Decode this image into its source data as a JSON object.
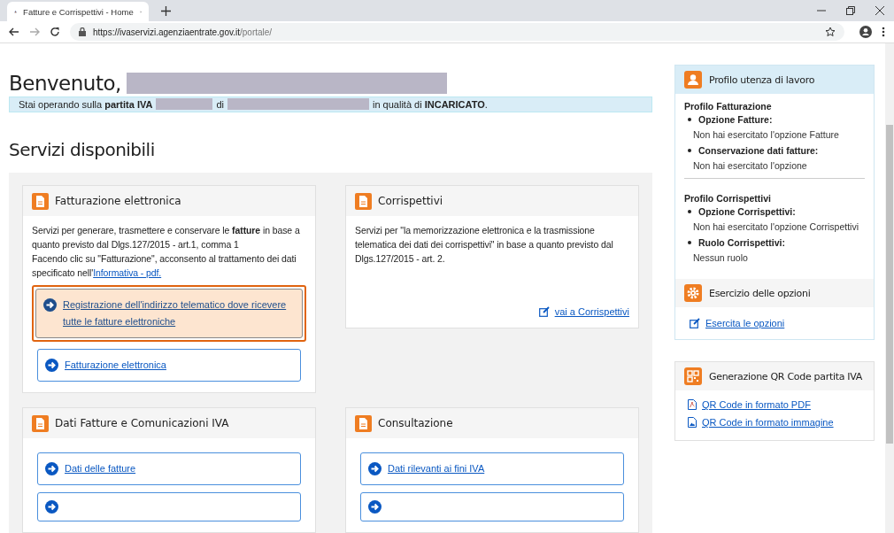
{
  "browser": {
    "tab_title": "Fatture e Corrispettivi - Home",
    "url_host": "https://ivaservizi.agenziaentrate.gov.it",
    "url_path": "/portale/"
  },
  "welcome": "Benvenuto,",
  "notice": {
    "prefix": "Stai operando sulla **partita IVA**",
    "middle": "di",
    "suffix": "in qualità di **INCARICATO**."
  },
  "services_title": "Servizi disponibili",
  "cards": [
    {
      "title": "Fatturazione elettronica",
      "paragraphs": [
        {
          "text": "Servizi per generare, trasmettere e conservare le **fatture** in base a quanto previsto dal Dlgs.127/2015 - art.1, comma 1"
        },
        {
          "text": "Facendo clic su \"Fatturazione\", acconsento al trattamento dei dati specificato nell'",
          "link": "Informativa - pdf."
        }
      ],
      "buttons": [
        {
          "label": "Registrazione dell'indirizzo telematico dove ricevere tutte le fatture elettroniche",
          "highlighted": true
        },
        {
          "label": "Fatturazione elettronica",
          "highlighted": false
        }
      ]
    },
    {
      "title": "Corrispettivi",
      "paragraphs": [
        {
          "text": "Servizi per \"la memorizzazione elettronica e la trasmissione telematica dei dati dei corrispettivi\" in base a quanto previsto dal Dlgs.127/2015 - art. 2."
        }
      ],
      "footer_link": "vai a Corrispettivi"
    },
    {
      "title": "Dati Fatture e Comunicazioni IVA",
      "buttons": [
        {
          "label": "Dati delle fatture",
          "highlighted": false
        },
        {
          "highlighted": false
        }
      ]
    },
    {
      "title": "Consultazione",
      "buttons": [
        {
          "label": "Dati rilevanti ai fini IVA",
          "highlighted": false
        },
        {
          "highlighted": false
        }
      ]
    }
  ],
  "sidebar": {
    "profile": {
      "title": "Profilo utenza di lavoro",
      "sections": [
        {
          "title": "Profilo Fatturazione",
          "items": [
            {
              "label": "Opzione Fatture:",
              "value": "Non hai esercitato l'opzione Fatture"
            },
            {
              "label": "Conservazione dati fatture:",
              "value": "Non hai esercitato l'opzione"
            }
          ]
        },
        {
          "title": "Profilo Corrispettivi",
          "items": [
            {
              "label": "Opzione Corrispettivi:",
              "value": "Non hai esercitato l'opzione Corrispettivi"
            },
            {
              "label": "Ruolo Corrispettivi:",
              "value": "Nessun ruolo"
            }
          ]
        }
      ],
      "options_title": "Esercizio delle opzioni",
      "options_link": "Esercita le opzioni"
    },
    "qr": {
      "title": "Generazione QR Code partita IVA",
      "links": [
        {
          "label": "QR Code in formato PDF",
          "kind": "pdf"
        },
        {
          "label": "QR Code in formato immagine",
          "kind": "image"
        }
      ]
    }
  }
}
